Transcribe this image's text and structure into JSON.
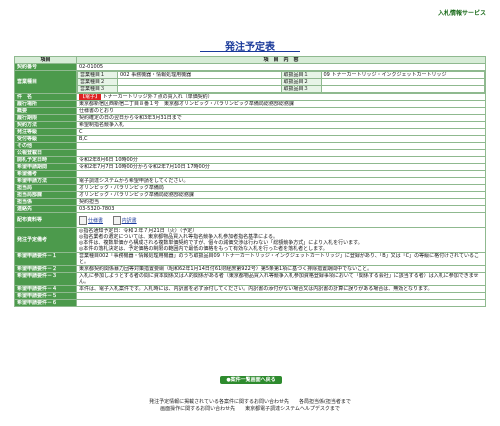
{
  "header": {
    "system_link": "入札情報サービス"
  },
  "page": {
    "title": "発注予定表"
  },
  "table": {
    "head_item": "項目",
    "head_content": "項　目　内　容"
  },
  "rows": {
    "keiyaku_no": {
      "label": "契約番号",
      "value": "02-01005"
    },
    "eigyo_shumoku": {
      "label": "営業種目",
      "items": [
        {
          "k": "営業種目１",
          "v": "002 事務機器・情報処理用機器",
          "k2": "取扱品目１",
          "v2": "09 トナーカートリッジ・インクジェットカートリッジ"
        },
        {
          "k": "営業種目２",
          "v": "",
          "k2": "取扱品目２",
          "v2": ""
        },
        {
          "k": "営業種目３",
          "v": "",
          "k2": "取扱品目３",
          "v2": ""
        }
      ]
    },
    "kenmei": {
      "label": "件　名",
      "badge": "【電子】",
      "value": "トナーカートリッジ外７点の買入れ（単価契約）"
    },
    "rikou_basho": {
      "label": "履行場所",
      "value": "東京都新宿区西新宿二丁目８番１号　東京都オリンピック・パラリンピック準備局総務部総務課"
    },
    "gaiyou": {
      "label": "概要",
      "value": "仕様書のとおり"
    },
    "rikou_kikan": {
      "label": "履行期限",
      "value": "契約確定の日の翌日から令和3年3月31日まで"
    },
    "keiyaku_houhou": {
      "label": "契約方法",
      "value": "希望制指名競争入札"
    },
    "hacchu_tokyu": {
      "label": "発注等級",
      "value": "C"
    },
    "juchu_tokyu": {
      "label": "受付等級",
      "value": "B,C"
    },
    "sonota": {
      "label": "その他",
      "value": ""
    },
    "kokoku": {
      "label": "公報登載日",
      "value": ""
    },
    "kaisatsu": {
      "label": "開札予定日時",
      "value": "令和2年8月6日 10時00分"
    },
    "kibo_kikan": {
      "label": "希望申請期間",
      "value": "令和2年7月7日 10時00分から令和2年7月10日 17時00分"
    },
    "kibo_biko": {
      "label": "希望備考",
      "value": ""
    },
    "kibo_houhou": {
      "label": "希望申請方法",
      "value": "電子調達システムから希望申請をしてください。"
    },
    "tanto_kyoku": {
      "label": "担当局",
      "value": "オリンピック・パラリンピック準備局"
    },
    "tanto_bu": {
      "label": "担当局部課",
      "value": "オリンピック・パラリンピック準備局総務部総務課"
    },
    "tanto_ka": {
      "label": "担当係",
      "value": "契約担当"
    },
    "renrakusaki": {
      "label": "連絡先",
      "value": "03-5320-7803"
    },
    "haifu": {
      "label": "配布資料等",
      "file1": "仕様書",
      "file2": "内訳書"
    },
    "hacchu_biko": {
      "label": "発注予定備考",
      "lines": [
        "◎指名通知予定日：令和２年７月21日（火）（予定）",
        "◎指名業者の選定については、東京都物品買入れ等指名競争入札参加者指名基準による。",
        "◎本件は、複数単価から構成される複数単価契約ですが、個々の減価交渉は行わない「総額競争方式」により入札を行います。",
        "◎本件の落札決定は、予定価格の制限の範囲内で最低の価格をもって有効な入札を行った者を落札者とします。"
      ]
    },
    "yoken1": {
      "label": "希望申請要件－１",
      "value": "営業種目002「事務機器・情報処理用機器」のうち取扱品目09「トナーカートリッジ・インクジェットカートリッジ」に登録があり、「B」又は「C」の等級に格付けされていること。"
    },
    "yoken2": {
      "label": "希望申請要件－２",
      "value": "東京都契約関係暴力団等対策措置要綱（昭和62年1月14日付61財経庶第922号）第5条第1項に基づく排除措置期間中でないこと。"
    },
    "yoken3": {
      "label": "希望申請要件－３",
      "value": "入札に参加しようとする者の間に資本関係又は人的関係がある者（東京都物品買入れ等競争入札参加資格登録事項において「関係する会社」に該当する者）は入札に参加できません。"
    },
    "yoken4": {
      "label": "希望申請要件－４",
      "value": "本件は、電子入札案件です。入札時には、内訳書を必ず添付してください。内訳書の添付がない場合又は内訳書の計算に誤りがある場合は、無効となります。"
    },
    "yoken5": {
      "label": "希望申請要件－５",
      "value": ""
    },
    "yoken6": {
      "label": "希望申請要件－６",
      "value": ""
    }
  },
  "buttons": {
    "back": "●案件一覧画面へ戻る"
  },
  "footer": {
    "line1": "発注予定情報に掲載されている各案件に関するお問い合わせ先　　各局担当係(担当者まで",
    "line2": "画面操作に関するお問い合わせ先　　東京都電子調達システムヘルプデスクまで"
  }
}
